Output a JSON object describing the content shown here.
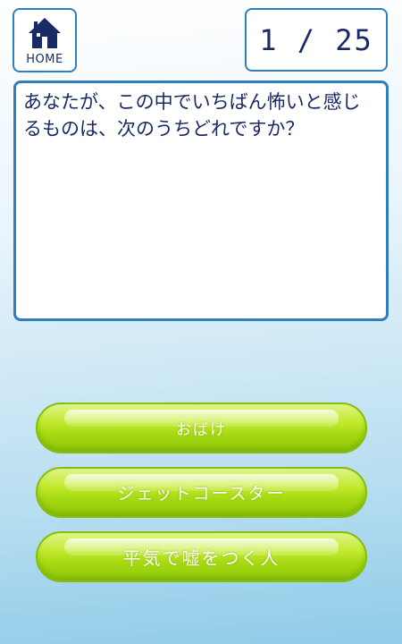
{
  "header": {
    "home_label": "HOME",
    "counter": "1 / 25"
  },
  "question": {
    "text": "あなたが、この中でいちばん怖いと感じるものは、次のうちどれですか？"
  },
  "answers": [
    {
      "label": "おばけ"
    },
    {
      "label": "ジェットコースター"
    },
    {
      "label": "平気で嘘をつく人"
    }
  ],
  "colors": {
    "accent_border": "#2d7fc0",
    "text_dark": "#1a2a66",
    "button_green": "#a6da12"
  },
  "icons": {
    "home": "house-icon"
  }
}
